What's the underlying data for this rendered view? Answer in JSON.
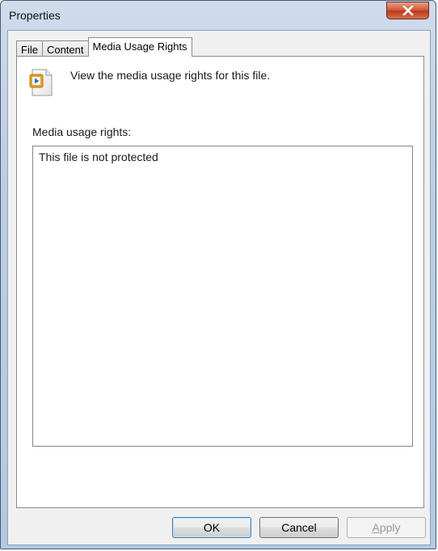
{
  "window": {
    "title": "Properties"
  },
  "titlebar": {
    "close_icon": "close-icon"
  },
  "tabs": [
    {
      "label": "File",
      "active": false
    },
    {
      "label": "Content",
      "active": false
    },
    {
      "label": "Media Usage Rights",
      "active": true
    }
  ],
  "panel": {
    "file_icon": "media-file-icon",
    "intro": "View the media usage rights for this file.",
    "rights_label": "Media usage rights:",
    "rights_value": "This file is not protected"
  },
  "buttons": {
    "ok": "OK",
    "cancel": "Cancel",
    "apply_first": "A",
    "apply_rest": "pply"
  },
  "colors": {
    "close_button": "#c0391c",
    "file_icon_accent": "#e8a020",
    "file_icon_play": "#2a6fd0"
  }
}
